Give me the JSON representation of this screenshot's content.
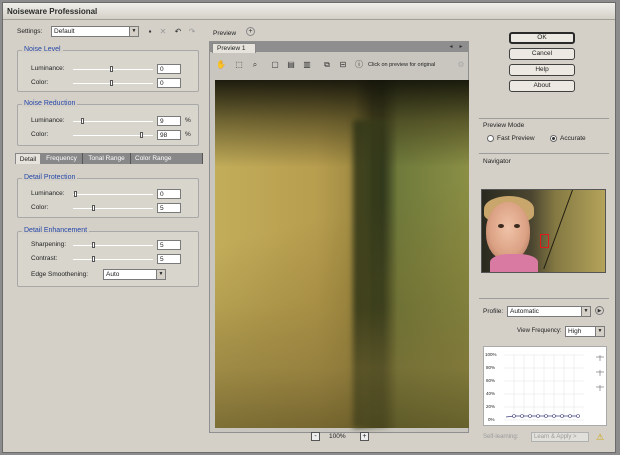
{
  "app": {
    "title": "Noiseware Professional"
  },
  "settings": {
    "label": "Settings:",
    "value": "Default"
  },
  "noise_level": {
    "title": "Noise Level",
    "rows": [
      {
        "label": "Luminance:",
        "value": "0"
      },
      {
        "label": "Color:",
        "value": "0"
      }
    ]
  },
  "noise_reduction": {
    "title": "Noise Reduction",
    "rows": [
      {
        "label": "Luminance:",
        "value": "9",
        "unit": "%"
      },
      {
        "label": "Color:",
        "value": "98",
        "unit": "%"
      }
    ]
  },
  "tabs": [
    "Detail",
    "Frequency",
    "Tonal Range",
    "Color Range"
  ],
  "detail_protection": {
    "title": "Detail Protection",
    "rows": [
      {
        "label": "Luminance:",
        "value": "0"
      },
      {
        "label": "Color:",
        "value": "5"
      }
    ]
  },
  "detail_enhancement": {
    "title": "Detail Enhancement",
    "rows": [
      {
        "label": "Sharpening:",
        "value": "5"
      },
      {
        "label": "Contrast:",
        "value": "5"
      }
    ],
    "edge_label": "Edge Smoothening:",
    "edge_value": "Auto"
  },
  "preview": {
    "label": "Preview",
    "tab": "Preview 1",
    "hint": "Click on preview for original",
    "zoom": "100%",
    "zoom_minus": "-",
    "zoom_plus": "+"
  },
  "buttons": {
    "ok": "OK",
    "cancel": "Cancel",
    "help": "Help",
    "about": "About"
  },
  "preview_mode": {
    "title": "Preview Mode",
    "fast": "Fast Preview",
    "accurate": "Accurate"
  },
  "navigator": {
    "title": "Navigator"
  },
  "profile": {
    "label": "Profile:",
    "value": "Automatic",
    "view_frequency_label": "View Frequency:",
    "view_frequency_value": "High",
    "y_ticks": [
      "100%",
      "80%",
      "60%",
      "40%",
      "20%",
      "0%"
    ],
    "self_learning": "Self-learning:",
    "learn_apply": "Learn & Apply >"
  }
}
